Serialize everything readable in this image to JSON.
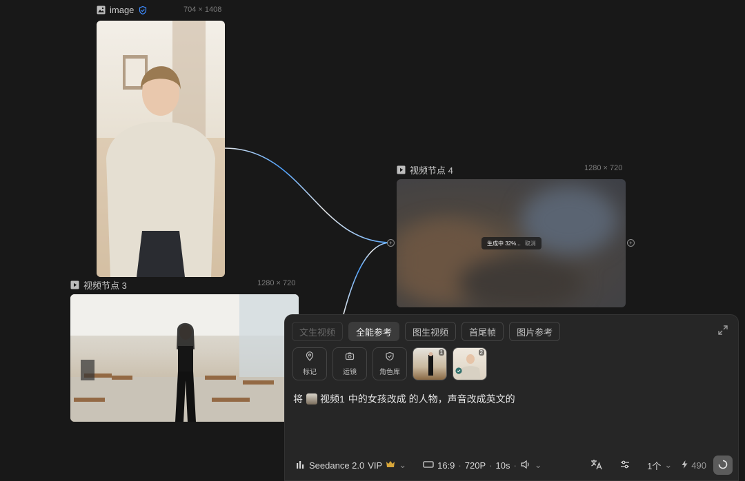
{
  "image_node": {
    "title": "image",
    "dimensions": "704 × 1408",
    "icon": "image-icon",
    "badge_icon": "verified-icon"
  },
  "video_node_3": {
    "title": "视频节点 3",
    "dimensions": "1280 × 720",
    "icon": "video-icon"
  },
  "video_node_4": {
    "title": "视频节点 4",
    "dimensions": "1280 × 720",
    "icon": "video-icon",
    "status_text": "生成中 32%...",
    "cancel_label": "取消",
    "progress": 0.32
  },
  "panel": {
    "tabs": [
      {
        "label": "文生视频",
        "state": "disabled"
      },
      {
        "label": "全能参考",
        "state": "active"
      },
      {
        "label": "图生视频",
        "state": "normal"
      },
      {
        "label": "首尾帧",
        "state": "normal"
      },
      {
        "label": "图片参考",
        "state": "normal"
      }
    ],
    "tools": [
      {
        "label": "标记",
        "icon": "location-pin-icon"
      },
      {
        "label": "运镜",
        "icon": "camera-icon"
      },
      {
        "label": "角色库",
        "icon": "shield-icon"
      }
    ],
    "references": [
      {
        "number": "1"
      },
      {
        "number": "2"
      }
    ],
    "prompt": {
      "prefix": "将",
      "chip_label": "视频1",
      "rest": "中的女孩改成 的人物，声音改成英文的"
    },
    "bottom": {
      "model": "Seedance 2.0",
      "model_badge": "VIP",
      "aspect": "16:9",
      "resolution": "720P",
      "duration": "10s",
      "count": "1个",
      "credits": "490"
    }
  },
  "colors": {
    "background": "#181818",
    "panel": "#262626",
    "accent_blue": "#3d8bff",
    "vip_gold": "#d7a63a"
  }
}
